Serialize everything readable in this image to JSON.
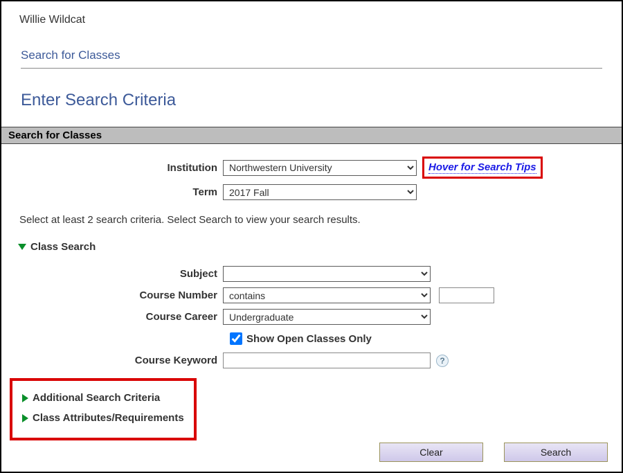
{
  "user_name": "Willie Wildcat",
  "subtitle": "Search for Classes",
  "title": "Enter Search Criteria",
  "section_header": "Search for Classes",
  "tips_link": "Hover for Search Tips",
  "instruction": "Select at least 2 search criteria. Select Search to view your search results.",
  "form": {
    "institution": {
      "label": "Institution",
      "value": "Northwestern University"
    },
    "term": {
      "label": "Term",
      "value": "2017 Fall"
    },
    "subject": {
      "label": "Subject",
      "value": ""
    },
    "course_number": {
      "label": "Course Number",
      "op": "contains",
      "value": ""
    },
    "course_career": {
      "label": "Course Career",
      "value": "Undergraduate"
    },
    "open_only": {
      "label": "Show Open Classes Only",
      "checked": true
    },
    "keyword": {
      "label": "Course Keyword",
      "value": ""
    }
  },
  "sections": {
    "class_search": "Class Search",
    "additional": "Additional Search Criteria",
    "attributes": "Class Attributes/Requirements"
  },
  "buttons": {
    "clear": "Clear",
    "search": "Search"
  },
  "help_icon": "?"
}
